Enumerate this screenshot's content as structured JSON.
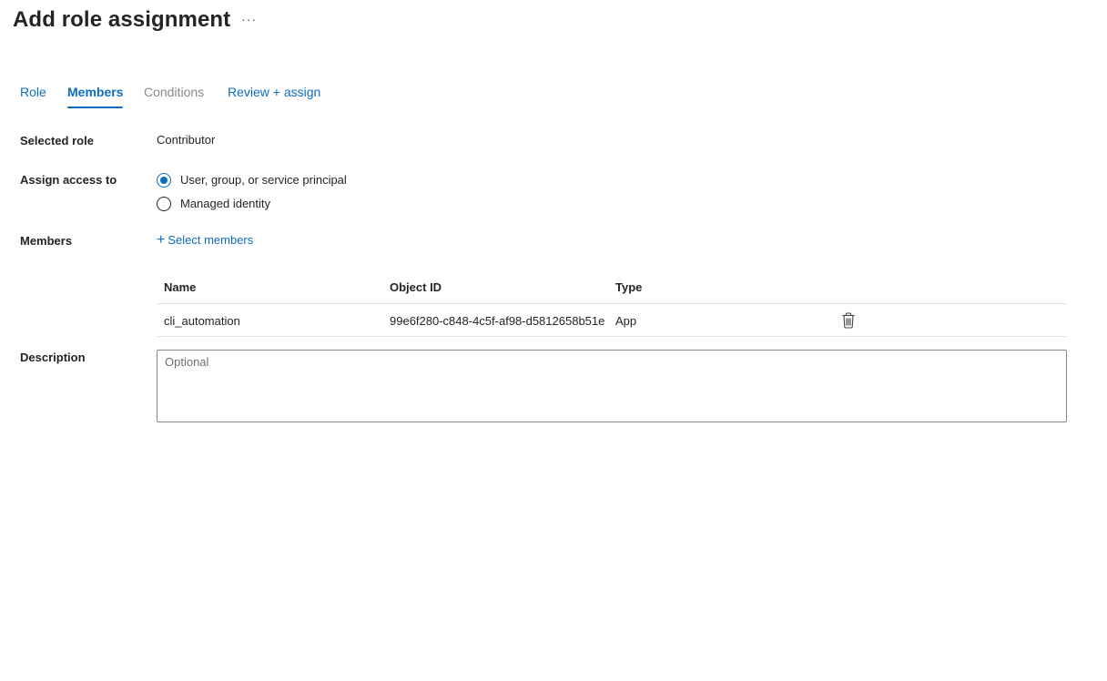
{
  "header": {
    "title": "Add role assignment",
    "more_label": "···"
  },
  "tabs": [
    {
      "label": "Role",
      "state": "link"
    },
    {
      "label": "Members",
      "state": "active"
    },
    {
      "label": "Conditions",
      "state": "disabled"
    },
    {
      "label": "Review + assign",
      "state": "link"
    }
  ],
  "form": {
    "selected_role": {
      "label": "Selected role",
      "value": "Contributor"
    },
    "assign_access": {
      "label": "Assign access to",
      "options": [
        {
          "label": "User, group, or service principal",
          "checked": true
        },
        {
          "label": "Managed identity",
          "checked": false
        }
      ]
    },
    "members": {
      "label": "Members",
      "select_link": "Select members",
      "table": {
        "columns": [
          "Name",
          "Object ID",
          "Type"
        ],
        "rows": [
          {
            "name": "cli_automation",
            "object_id": "99e6f280-c848-4c5f-af98-d5812658b51e",
            "type": "App",
            "action_icon": "trash-icon"
          }
        ]
      }
    },
    "description": {
      "label": "Description",
      "placeholder": "Optional",
      "value": ""
    }
  },
  "colors": {
    "accent": "#0f6cbd",
    "text": "#242424",
    "disabled": "#8a8886",
    "border": "#e0e0e0"
  }
}
